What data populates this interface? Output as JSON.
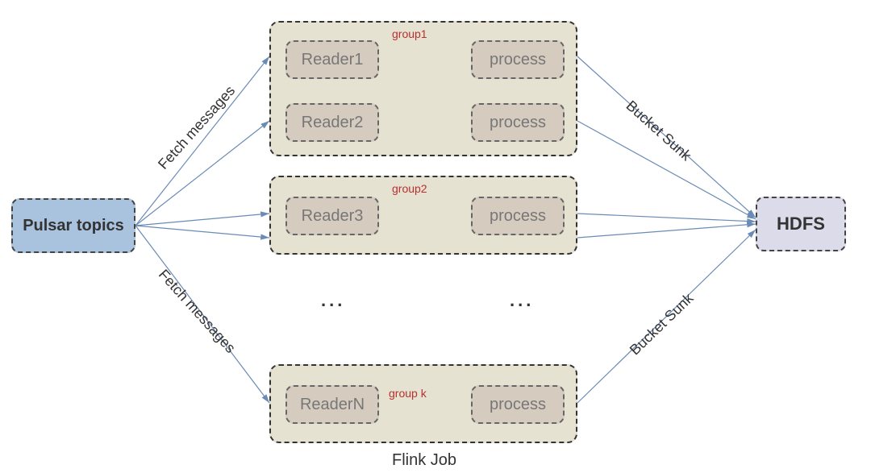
{
  "nodes": {
    "source": "Pulsar topics",
    "sink": "HDFS"
  },
  "groups": [
    {
      "label": "group1",
      "readers": [
        "Reader1",
        "Reader2"
      ],
      "processes": [
        "process",
        "process"
      ]
    },
    {
      "label": "group2",
      "readers": [
        "Reader3"
      ],
      "processes": [
        "process"
      ]
    },
    {
      "label": "group k",
      "readers": [
        "ReaderN"
      ],
      "processes": [
        "process"
      ]
    }
  ],
  "edgeLabels": {
    "fetchTop": "Fetch messages",
    "fetchBottom": "Fetch messages",
    "sunkTop": "Bucket Sunk",
    "sunkBottom": "Bucket Sunk"
  },
  "caption": "Flink Job",
  "ellipsis": "..."
}
